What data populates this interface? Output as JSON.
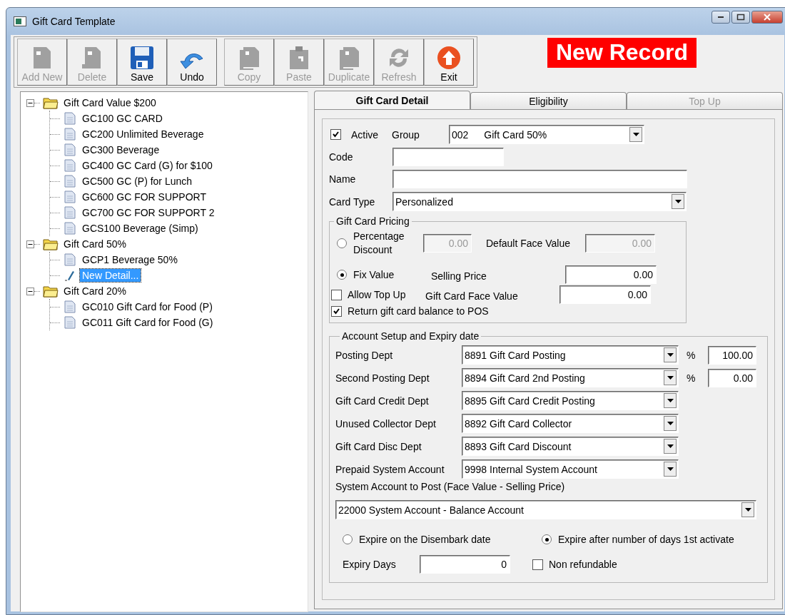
{
  "window": {
    "title": "Gift Card Template"
  },
  "toolbar": [
    [
      {
        "label": "Add New",
        "kind": "doc",
        "disabled": true
      },
      {
        "label": "Delete",
        "kind": "delete",
        "disabled": true
      },
      {
        "label": "Save",
        "kind": "save",
        "disabled": false
      },
      {
        "label": "Undo",
        "kind": "undo",
        "disabled": false
      }
    ],
    [
      {
        "label": "Copy",
        "kind": "copy",
        "disabled": true
      },
      {
        "label": "Paste",
        "kind": "paste",
        "disabled": true
      },
      {
        "label": "Duplicate",
        "kind": "copy",
        "disabled": true
      },
      {
        "label": "Refresh",
        "kind": "refresh",
        "disabled": true
      },
      {
        "label": "Exit",
        "kind": "exit",
        "disabled": false
      }
    ]
  ],
  "banner": "New Record",
  "tree": [
    {
      "label": "Gift Card Value $200",
      "expanded": true,
      "children": [
        {
          "label": "GC100 GC CARD",
          "kind": "doc",
          "selected": false
        },
        {
          "label": "GC200 Unlimited Beverage",
          "kind": "doc",
          "selected": false
        },
        {
          "label": "GC300 Beverage",
          "kind": "doc",
          "selected": false
        },
        {
          "label": "GC400 GC Card (G) for $100",
          "kind": "doc",
          "selected": false
        },
        {
          "label": "GC500 GC (P) for Lunch",
          "kind": "doc",
          "selected": false
        },
        {
          "label": "GC600 GC FOR SUPPORT",
          "kind": "doc",
          "selected": false
        },
        {
          "label": "GC700 GC FOR SUPPORT 2",
          "kind": "doc",
          "selected": false
        },
        {
          "label": "GCS100 Beverage (Simp)",
          "kind": "doc",
          "selected": false
        }
      ]
    },
    {
      "label": "Gift Card 50%",
      "expanded": true,
      "children": [
        {
          "label": "GCP1 Beverage 50%",
          "kind": "doc",
          "selected": false
        },
        {
          "label": "New Detail...",
          "kind": "new",
          "selected": true
        }
      ]
    },
    {
      "label": "Gift Card 20%",
      "expanded": true,
      "children": [
        {
          "label": "GC010 Gift Card for Food (P)",
          "kind": "doc",
          "selected": false
        },
        {
          "label": "GC011 Gift Card for Food (G)",
          "kind": "doc",
          "selected": false
        }
      ]
    }
  ],
  "tabs": [
    {
      "label": "Gift Card Detail",
      "selected": true,
      "disabled": false
    },
    {
      "label": "Eligibility",
      "selected": false,
      "disabled": false
    },
    {
      "label": "Top Up",
      "selected": false,
      "disabled": true
    }
  ],
  "detail": {
    "active": {
      "label": "Active",
      "checked": true
    },
    "group": {
      "label": "Group",
      "code": "002",
      "value": "Gift Card 50%"
    },
    "code": {
      "label": "Code"
    },
    "name": {
      "label": "Name"
    },
    "card_type": {
      "label": "Card Type",
      "value": "Personalized"
    },
    "pricing": {
      "title": "Gift Card Pricing",
      "percentage_discount": {
        "label": "Percentage Discount",
        "selected": false,
        "value": "0.00",
        "disabled": true
      },
      "default_face_value": {
        "label": "Default Face Value",
        "value": "0.00",
        "disabled": true
      },
      "fix_value": {
        "label": "Fix Value",
        "selected": true
      },
      "selling_price": {
        "label": "Selling Price",
        "value": "0.00"
      },
      "allow_top_up": {
        "label": "Allow Top Up",
        "checked": false
      },
      "gift_card_face_value": {
        "label": "Gift Card Face Value",
        "value": "0.00"
      },
      "return_balance": {
        "label": "Return gift card balance to POS",
        "checked": true
      }
    },
    "account": {
      "title": "Account Setup and Expiry date",
      "depts": [
        {
          "label": "Posting Dept",
          "value": "8891 Gift Card Posting",
          "percent_sign": "%",
          "percent": "100.00"
        },
        {
          "label": "Second Posting Dept",
          "value": "8894 Gift Card 2nd Posting",
          "percent_sign": "%",
          "percent": "0.00"
        },
        {
          "label": "Gift Card Credit Dept",
          "value": "8895 Gift Card Credit Posting"
        },
        {
          "label": "Unused Collector Dept",
          "value": "8892 Gift Card Collector"
        },
        {
          "label": "Gift Card Disc Dept",
          "value": "8893 Gift Card Discount"
        },
        {
          "label": "Prepaid System Account",
          "value": "9998 Internal System Account"
        }
      ],
      "system_account": {
        "label": "System Account to Post (Face Value - Selling Price)",
        "value": "22000 System Account - Balance Account"
      },
      "expire_options": [
        {
          "label": "Expire on the Disembark date",
          "selected": false
        },
        {
          "label": "Expire after number of days 1st activate",
          "selected": true
        }
      ],
      "expiry_days": {
        "label": "Expiry Days",
        "value": "0"
      },
      "non_refundable": {
        "label": "Non refundable",
        "checked": false
      }
    }
  }
}
